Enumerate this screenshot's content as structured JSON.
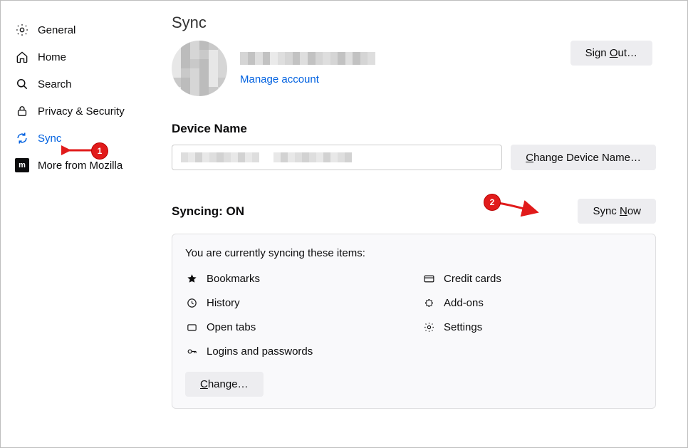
{
  "sidebar": {
    "items": [
      {
        "label": "General"
      },
      {
        "label": "Home"
      },
      {
        "label": "Search"
      },
      {
        "label": "Privacy & Security"
      },
      {
        "label": "Sync"
      },
      {
        "label": "More from Mozilla"
      }
    ]
  },
  "page": {
    "title": "Sync"
  },
  "account": {
    "manage_link": "Manage account",
    "sign_out_label_prefix": "Sign ",
    "sign_out_label_ul": "O",
    "sign_out_label_suffix": "ut…"
  },
  "device": {
    "header": "Device Name",
    "change_label_ul": "C",
    "change_label_rest": "hange Device Name…"
  },
  "syncstatus": {
    "label": "Syncing: ON",
    "now_prefix": "Sync ",
    "now_ul": "N",
    "now_suffix": "ow"
  },
  "syncbox": {
    "intro": "You are currently syncing these items:",
    "items_col1": [
      {
        "label": "Bookmarks"
      },
      {
        "label": "History"
      },
      {
        "label": "Open tabs"
      },
      {
        "label": "Logins and passwords"
      }
    ],
    "items_col2": [
      {
        "label": "Credit cards"
      },
      {
        "label": "Add-ons"
      },
      {
        "label": "Settings"
      }
    ],
    "change_ul": "C",
    "change_rest": "hange…"
  },
  "annotations": {
    "badge1": "1",
    "badge2": "2"
  }
}
